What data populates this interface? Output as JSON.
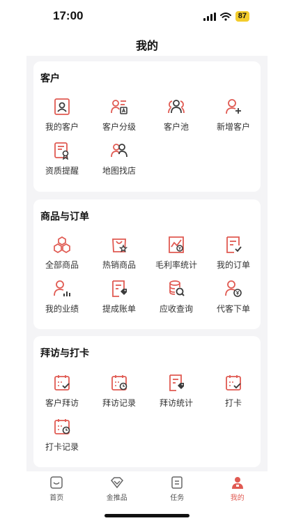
{
  "status": {
    "time": "17:00",
    "battery": "87"
  },
  "nav": {
    "title": "我的"
  },
  "sections": {
    "customer": {
      "title": "客户",
      "items": [
        "我的客户",
        "客户分级",
        "客户池",
        "新增客户",
        "资质提醒",
        "地图找店"
      ]
    },
    "orders": {
      "title": "商品与订单",
      "items": [
        "全部商品",
        "热销商品",
        "毛利率统计",
        "我的订单",
        "我的业绩",
        "提成账单",
        "应收查询",
        "代客下单"
      ]
    },
    "visits": {
      "title": "拜访与打卡",
      "items": [
        "客户拜访",
        "拜访记录",
        "拜访统计",
        "打卡",
        "打卡记录"
      ]
    }
  },
  "tabbar": {
    "items": [
      {
        "label": "首页",
        "icon": "home-icon"
      },
      {
        "label": "金推品",
        "icon": "diamond-icon"
      },
      {
        "label": "任务",
        "icon": "task-icon"
      },
      {
        "label": "我的",
        "icon": "profile-icon"
      }
    ],
    "active_index": 3
  },
  "colors": {
    "accent": "#e05a52",
    "dark": "#3a3a3a",
    "background": "#f4f4f6"
  }
}
